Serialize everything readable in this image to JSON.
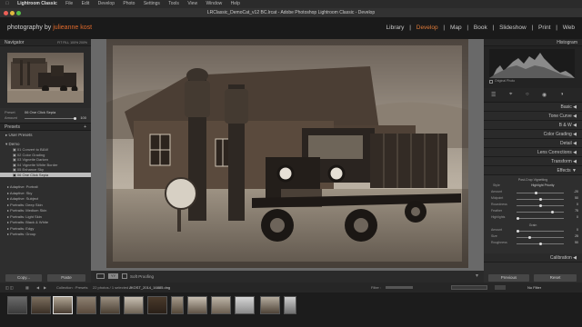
{
  "menubar": {
    "app": "Lightroom Classic",
    "items": [
      "File",
      "Edit",
      "Develop",
      "Photo",
      "Settings",
      "Tools",
      "View",
      "Window",
      "Help"
    ]
  },
  "titlebar": {
    "title": "LRClassic_DemoCat_v12 BC.lrcat - Adobe Photoshop Lightroom Classic - Develop"
  },
  "brand": {
    "prefix": "photography by",
    "name": "julieanne kost"
  },
  "modules": {
    "items": [
      "Library",
      "Develop",
      "Map",
      "Book",
      "Slideshow",
      "Print",
      "Web"
    ],
    "active": "Develop",
    "separator": "|"
  },
  "navigator": {
    "label": "Navigator",
    "zoom_options": [
      "FIT",
      "FILL",
      "100%",
      "200%"
    ]
  },
  "preset_amount": {
    "preset_label": "Preset",
    "preset_value": "06 One Click Sepia",
    "amount_label": "Amount",
    "amount_value": "100"
  },
  "presets": {
    "label": "Presets",
    "user_presets": "User Presets",
    "group": "Demo",
    "items": [
      "01 Convert to B&W",
      "02 Color Grading",
      "03 Vignette Darken",
      "04 Vignette White Border",
      "05 Enhance Sky",
      "06 One Click Sepia"
    ],
    "selected": "06 One Click Sepia",
    "folders": [
      "Adaptive: Portrait",
      "Adaptive: Sky",
      "Adaptive: Subject",
      "Portraits: Deep Skin",
      "Portraits: Medium Skin",
      "Portraits: Light Skin",
      "Portraits: Black & White",
      "Portraits: Edgy",
      "Portraits: Group"
    ]
  },
  "left_buttons": {
    "copy": "Copy...",
    "paste": "Paste"
  },
  "toolbar": {
    "soft_proofing": "Soft Proofing"
  },
  "histogram": {
    "label": "Histogram",
    "original_photo": "Original Photo"
  },
  "right_sections": [
    "Basic",
    "Tone Curve",
    "B & W",
    "Color Grading",
    "Detail",
    "Lens Corrections",
    "Transform",
    "Effects"
  ],
  "effects": {
    "vignette_label": "Post-Crop Vignetting",
    "style_label": "Style",
    "style_value": "Highlight Priority",
    "sliders": [
      {
        "label": "Amount",
        "value": "-20",
        "frac": 0.4
      },
      {
        "label": "Midpoint",
        "value": "50",
        "frac": 0.5
      },
      {
        "label": "Roundness",
        "value": "0",
        "frac": 0.5
      },
      {
        "label": "Feather",
        "value": "75",
        "frac": 0.75
      },
      {
        "label": "Highlights",
        "value": "0",
        "frac": 0.0
      }
    ],
    "grain_label": "Grain",
    "grain_sliders": [
      {
        "label": "Amount",
        "value": "0",
        "frac": 0.0
      },
      {
        "label": "Size",
        "value": "25",
        "frac": 0.25
      },
      {
        "label": "Roughness",
        "value": "50",
        "frac": 0.5
      }
    ]
  },
  "calibration": "Calibration",
  "right_buttons": {
    "previous": "Previous",
    "reset": "Reset"
  },
  "filmstrip_bar": {
    "collection": "Collection : Presets",
    "count": "22 photos / 1 selected /",
    "filename": "JKOST_2014_16885.dng",
    "filter_label": "Filter :",
    "filter_value": "No Filter"
  },
  "colors": {
    "accent": "#e07b39",
    "panel": "#2e2e2e",
    "workspace": "#696969"
  }
}
